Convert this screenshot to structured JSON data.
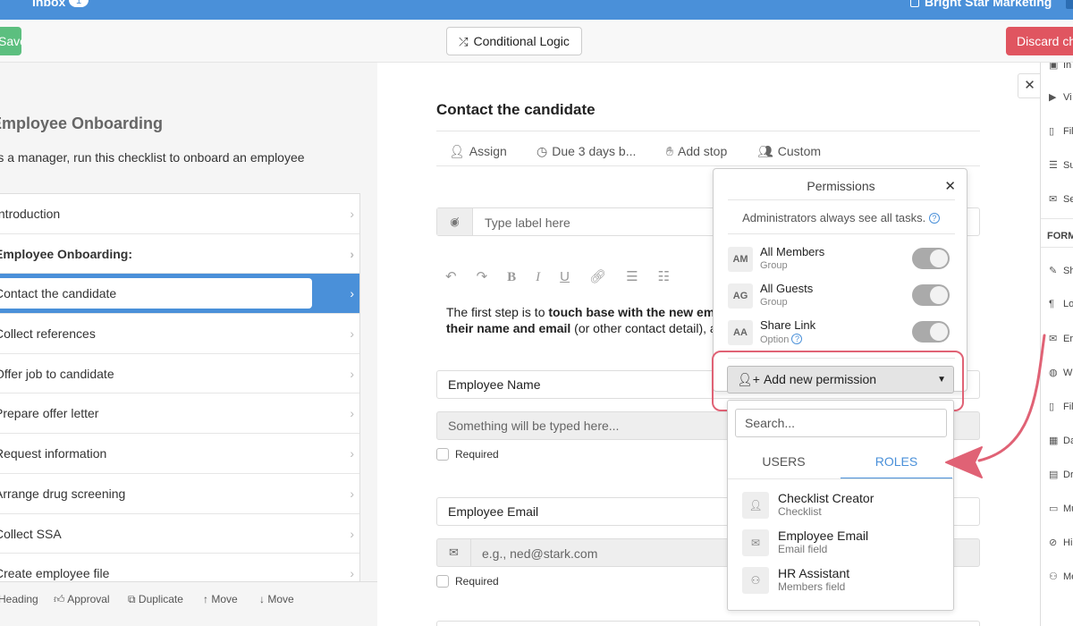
{
  "topbar": {
    "inbox_label": "Inbox",
    "inbox_count": "1",
    "org_name": "Bright Star Marketing"
  },
  "toolbar": {
    "left_button": "Save changes",
    "conditional_logic": "Conditional Logic",
    "discard": "Discard changes"
  },
  "checklist": {
    "title": "Employee Onboarding",
    "description": "As a manager, run this checklist to onboard an employee",
    "tasks": [
      {
        "label": "Introduction"
      },
      {
        "label": "Employee Onboarding:"
      },
      {
        "label": "Contact the candidate"
      },
      {
        "label": "Collect references"
      },
      {
        "label": "Offer job to candidate"
      },
      {
        "label": "Prepare offer letter"
      },
      {
        "label": "Request information"
      },
      {
        "label": "Arrange drug screening"
      },
      {
        "label": "Collect SSA"
      },
      {
        "label": "Create employee file"
      }
    ],
    "bottom_actions": [
      "Heading",
      "Approval",
      "Duplicate",
      "Move",
      "Move"
    ]
  },
  "task": {
    "title": "Contact the candidate",
    "actions": [
      "Assign",
      "Due 3 days b...",
      "Add stop",
      "Custom"
    ],
    "label_placeholder": "Type label here",
    "body_line1_plain": "The first step is to ",
    "body_line1_bold": "touch base with the new emp",
    "body_line2_bold": "their name and email",
    "body_line2_plain": " (or other contact detail), a",
    "field1_label": "Employee Name",
    "field1_placeholder": "Something will be typed here...",
    "required_label": "Required",
    "field2_label": "Employee Email",
    "field2_placeholder": "e.g., ned@stark.com"
  },
  "permissions": {
    "title": "Permissions",
    "admin_note": "Administrators always see all tasks.",
    "rows": [
      {
        "initials": "AM",
        "name": "All Members",
        "type": "Group",
        "enabled": true
      },
      {
        "initials": "AG",
        "name": "All Guests",
        "type": "Group",
        "enabled": true
      },
      {
        "initials": "AA",
        "name": "Share Link",
        "type": "Option",
        "enabled": true
      }
    ],
    "add_button": "Add new permission",
    "search_placeholder": "Search...",
    "tabs": [
      "USERS",
      "ROLES"
    ],
    "active_tab": "ROLES",
    "roles": [
      {
        "name": "Checklist Creator",
        "sub": "Checklist",
        "icon": "user-icon"
      },
      {
        "name": "Employee Email",
        "sub": "Email field",
        "icon": "envelope-icon"
      },
      {
        "name": "HR Assistant",
        "sub": "Members field",
        "icon": "members-icon"
      }
    ]
  },
  "right_panel": {
    "items": [
      "In",
      "Vi",
      "Fil",
      "Su",
      "Se",
      "FORM",
      "Sh",
      "Lo",
      "Er",
      "W",
      "Fil",
      "Da",
      "Dr",
      "Mu",
      "Hi",
      "Me"
    ]
  },
  "colors": {
    "accent": "#4a90d9",
    "green": "#5cbf7f",
    "danger": "#e05560",
    "annotation": "#e06275"
  }
}
